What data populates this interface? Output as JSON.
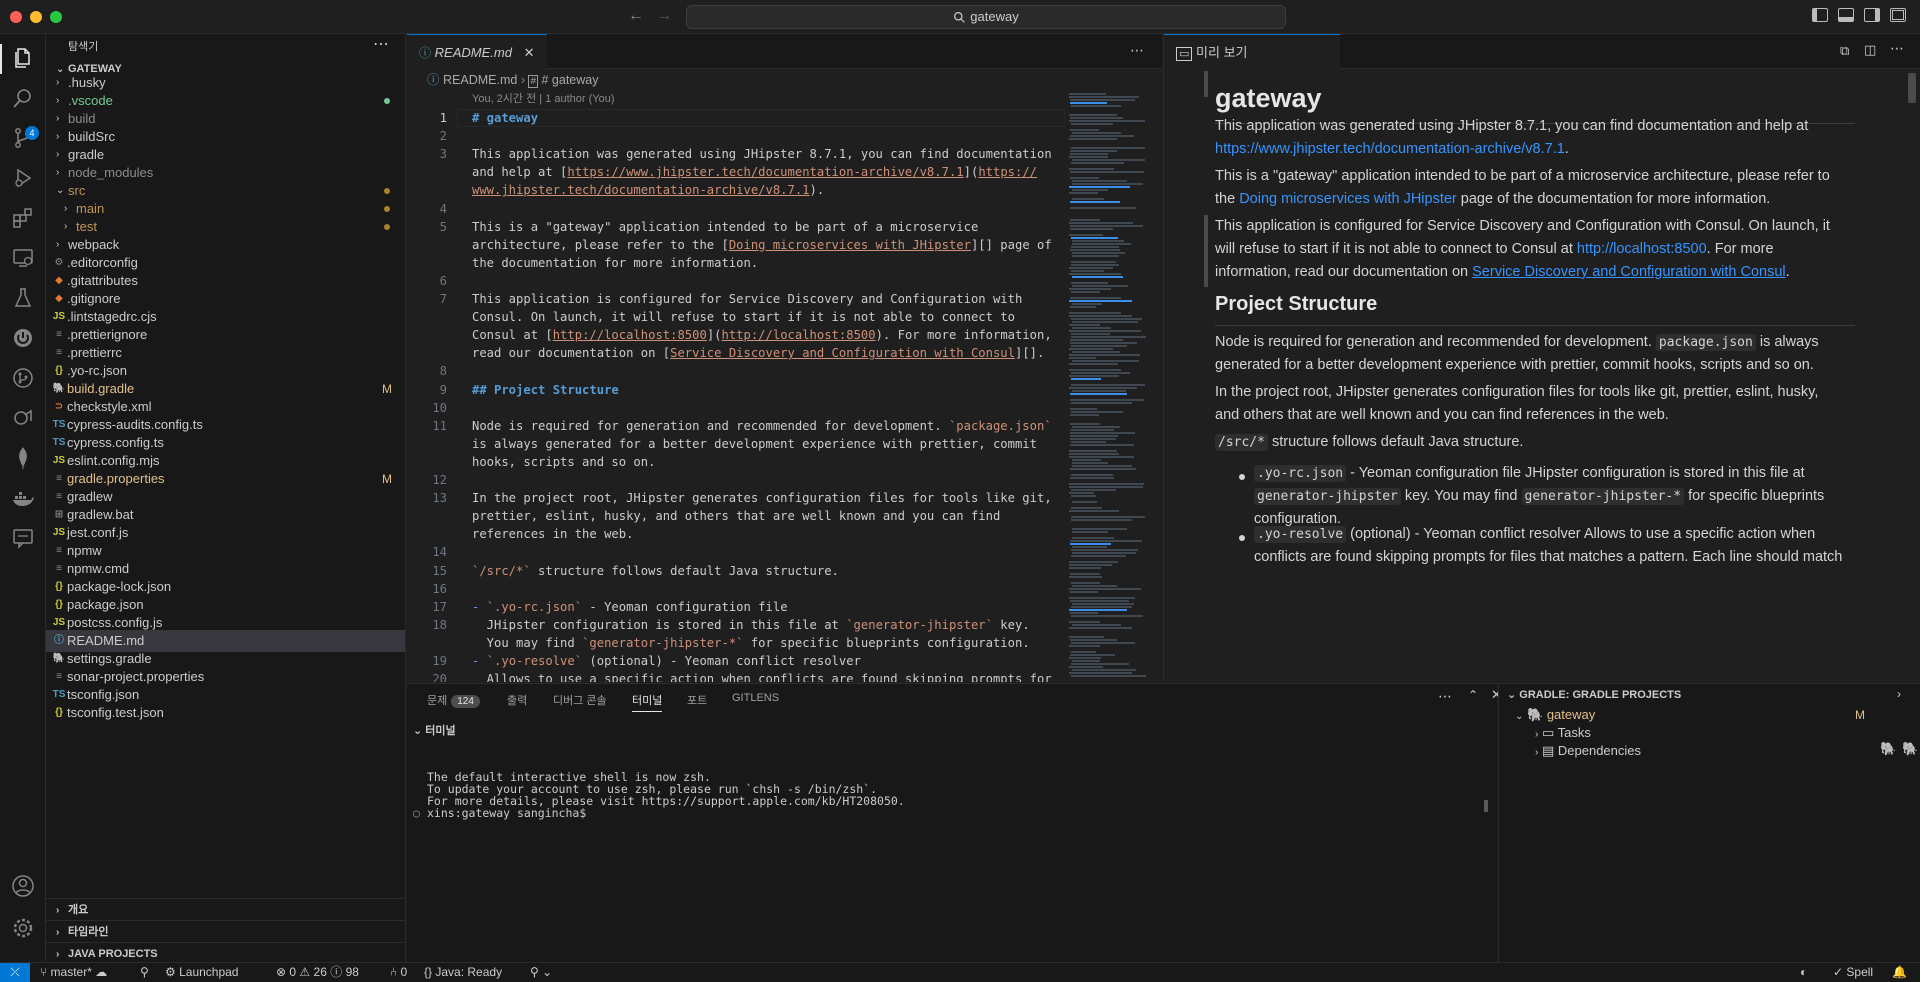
{
  "titlebar": {
    "search_text": "gateway"
  },
  "activity_bar": {
    "icons": [
      "explorer-icon",
      "search-icon",
      "source-control-icon",
      "run-debug-icon",
      "extensions-icon",
      "remote-explorer-icon",
      "testing-icon",
      "spring-boot-icon",
      "gitlens-icon",
      "gradle-icon",
      "mongodb-icon",
      "docker-icon",
      "comments-icon",
      "account-icon",
      "settings-gear-icon"
    ],
    "source_control_badge": "4"
  },
  "sidebar": {
    "title": "탐색기",
    "root": "GATEWAY",
    "items": [
      {
        "label": ".husky",
        "type": "folder",
        "color": "#cccccc"
      },
      {
        "label": ".vscode",
        "type": "folder",
        "color": "#73c991",
        "status": "dot-green"
      },
      {
        "label": "build",
        "type": "folder",
        "color": "#8c8c8c"
      },
      {
        "label": "buildSrc",
        "type": "folder",
        "color": "#cccccc"
      },
      {
        "label": "gradle",
        "type": "folder",
        "color": "#cccccc"
      },
      {
        "label": "node_modules",
        "type": "folder",
        "color": "#8c8c8c"
      },
      {
        "label": "src",
        "type": "folder-open",
        "color": "#c09553",
        "status": "dot-yellow"
      },
      {
        "label": "main",
        "type": "folder",
        "color": "#c09553",
        "status": "dot-yellow",
        "depth": 1
      },
      {
        "label": "test",
        "type": "folder",
        "color": "#c09553",
        "status": "dot-yellow",
        "depth": 1
      },
      {
        "label": "webpack",
        "type": "folder",
        "color": "#cccccc"
      },
      {
        "label": ".editorconfig",
        "type": "file",
        "icon": "gear",
        "color": "#cccccc"
      },
      {
        "label": ".gitattributes",
        "type": "file",
        "icon": "git",
        "color": "#cccccc"
      },
      {
        "label": ".gitignore",
        "type": "file",
        "icon": "git",
        "color": "#cccccc"
      },
      {
        "label": ".lintstagedrc.cjs",
        "type": "file",
        "icon": "JS",
        "color": "#cccccc"
      },
      {
        "label": ".prettierignore",
        "type": "file",
        "icon": "lines",
        "color": "#cccccc"
      },
      {
        "label": ".prettierrc",
        "type": "file",
        "icon": "lines",
        "color": "#cccccc"
      },
      {
        "label": ".yo-rc.json",
        "type": "file",
        "icon": "{}",
        "color": "#cccccc"
      },
      {
        "label": "build.gradle",
        "type": "file",
        "icon": "elephant",
        "color": "#e2c08d",
        "mark": "M"
      },
      {
        "label": "checkstyle.xml",
        "type": "file",
        "icon": "rss",
        "color": "#cccccc"
      },
      {
        "label": "cypress-audits.config.ts",
        "type": "file",
        "icon": "TS",
        "color": "#cccccc"
      },
      {
        "label": "cypress.config.ts",
        "type": "file",
        "icon": "TS",
        "color": "#cccccc"
      },
      {
        "label": "eslint.config.mjs",
        "type": "file",
        "icon": "JS",
        "color": "#cccccc"
      },
      {
        "label": "gradle.properties",
        "type": "file",
        "icon": "lines",
        "color": "#e2c08d",
        "mark": "M"
      },
      {
        "label": "gradlew",
        "type": "file",
        "icon": "lines",
        "color": "#cccccc"
      },
      {
        "label": "gradlew.bat",
        "type": "file",
        "icon": "win",
        "color": "#cccccc"
      },
      {
        "label": "jest.conf.js",
        "type": "file",
        "icon": "JS",
        "color": "#cccccc"
      },
      {
        "label": "npmw",
        "type": "file",
        "icon": "lines",
        "color": "#cccccc"
      },
      {
        "label": "npmw.cmd",
        "type": "file",
        "icon": "lines",
        "color": "#cccccc"
      },
      {
        "label": "package-lock.json",
        "type": "file",
        "icon": "{}",
        "color": "#cccccc"
      },
      {
        "label": "package.json",
        "type": "file",
        "icon": "{}",
        "color": "#cccccc"
      },
      {
        "label": "postcss.config.js",
        "type": "file",
        "icon": "JS",
        "color": "#cccccc"
      },
      {
        "label": "README.md",
        "type": "file",
        "icon": "info",
        "color": "#cccccc",
        "selected": true
      },
      {
        "label": "settings.gradle",
        "type": "file",
        "icon": "elephant",
        "color": "#cccccc"
      },
      {
        "label": "sonar-project.properties",
        "type": "file",
        "icon": "lines",
        "color": "#cccccc"
      },
      {
        "label": "tsconfig.json",
        "type": "file",
        "icon": "TS",
        "color": "#cccccc"
      },
      {
        "label": "tsconfig.test.json",
        "type": "file",
        "icon": "{}",
        "color": "#cccccc"
      }
    ],
    "sections": [
      "개요",
      "타임라인",
      "JAVA PROJECTS"
    ]
  },
  "editor": {
    "tab_label": "README.md",
    "breadcrumb_file": "README.md",
    "breadcrumb_symbol": "# gateway",
    "blame": "You, 2시간 전 | 1 author (You)",
    "lines": [
      {
        "n": "1",
        "segs": [
          [
            "h1",
            "# gateway"
          ]
        ]
      },
      {
        "n": "2",
        "segs": []
      },
      {
        "n": "3",
        "segs": [
          [
            "t",
            "This application was generated using JHipster 8.7.1, you can find documentation"
          ]
        ]
      },
      {
        "n": "",
        "segs": [
          [
            "t",
            "and help at ["
          ],
          [
            "link",
            "https://www.jhipster.tech/documentation-archive/v8.7.1"
          ],
          [
            "t",
            "]("
          ],
          [
            "link",
            "https://"
          ]
        ]
      },
      {
        "n": "",
        "segs": [
          [
            "link",
            "www.jhipster.tech/documentation-archive/v8.7.1"
          ],
          [
            "t",
            ")."
          ]
        ]
      },
      {
        "n": "4",
        "segs": []
      },
      {
        "n": "5",
        "segs": [
          [
            "t",
            "This is a \"gateway\" application intended to be part of a microservice"
          ]
        ]
      },
      {
        "n": "",
        "segs": [
          [
            "t",
            "architecture, please refer to the ["
          ],
          [
            "link",
            "Doing microservices with JHipster"
          ],
          [
            "t",
            "][] page of"
          ]
        ]
      },
      {
        "n": "",
        "segs": [
          [
            "t",
            "the documentation for more information."
          ]
        ]
      },
      {
        "n": "6",
        "segs": []
      },
      {
        "n": "7",
        "segs": [
          [
            "t",
            "This application is configured for Service Discovery and Configuration with"
          ]
        ]
      },
      {
        "n": "",
        "segs": [
          [
            "t",
            "Consul. On launch, it will refuse to start if it is not able to connect to"
          ]
        ]
      },
      {
        "n": "",
        "segs": [
          [
            "t",
            "Consul at ["
          ],
          [
            "link",
            "http://localhost:8500"
          ],
          [
            "t",
            "]("
          ],
          [
            "link",
            "http://localhost:8500"
          ],
          [
            "t",
            "). For more information,"
          ]
        ]
      },
      {
        "n": "",
        "segs": [
          [
            "t",
            "read our documentation on ["
          ],
          [
            "link",
            "Service Discovery and Configuration with Consul"
          ],
          [
            "t",
            "][]."
          ]
        ]
      },
      {
        "n": "8",
        "segs": []
      },
      {
        "n": "9",
        "segs": [
          [
            "h1",
            "## Project Structure"
          ]
        ]
      },
      {
        "n": "10",
        "segs": []
      },
      {
        "n": "11",
        "segs": [
          [
            "t",
            "Node is required for generation and recommended for development. "
          ],
          [
            "code",
            "`package.json`"
          ]
        ]
      },
      {
        "n": "",
        "segs": [
          [
            "t",
            "is always generated for a better development experience with prettier, commit"
          ]
        ]
      },
      {
        "n": "",
        "segs": [
          [
            "t",
            "hooks, scripts and so on."
          ]
        ]
      },
      {
        "n": "12",
        "segs": []
      },
      {
        "n": "13",
        "segs": [
          [
            "t",
            "In the project root, JHipster generates configuration files for tools like git,"
          ]
        ]
      },
      {
        "n": "",
        "segs": [
          [
            "t",
            "prettier, eslint, husky, and others that are well known and you can find"
          ]
        ]
      },
      {
        "n": "",
        "segs": [
          [
            "t",
            "references in the web."
          ]
        ]
      },
      {
        "n": "14",
        "segs": []
      },
      {
        "n": "15",
        "segs": [
          [
            "code",
            "`/src/*`"
          ],
          [
            "t",
            " structure follows default Java structure."
          ]
        ]
      },
      {
        "n": "16",
        "segs": []
      },
      {
        "n": "17",
        "segs": [
          [
            "bullet",
            "- "
          ],
          [
            "code",
            "`.yo-rc.json`"
          ],
          [
            "t",
            " - Yeoman configuration file"
          ]
        ]
      },
      {
        "n": "18",
        "segs": [
          [
            "t",
            "  JHipster configuration is stored in this file at "
          ],
          [
            "code",
            "`generator-jhipster`"
          ],
          [
            "t",
            " key."
          ]
        ]
      },
      {
        "n": "",
        "segs": [
          [
            "t",
            "  You may find "
          ],
          [
            "code",
            "`generator-jhipster-*`"
          ],
          [
            "t",
            " for specific blueprints configuration."
          ]
        ]
      },
      {
        "n": "19",
        "segs": [
          [
            "bullet",
            "- "
          ],
          [
            "code",
            "`.yo-resolve`"
          ],
          [
            "t",
            " (optional) - Yeoman conflict resolver"
          ]
        ]
      },
      {
        "n": "20",
        "segs": [
          [
            "t",
            "  Allows to use a specific action when conflicts are found skipping prompts for"
          ]
        ]
      }
    ]
  },
  "preview": {
    "tab_label": "미리 보기 README.md",
    "h1": "gateway",
    "p1_a": "This application was generated using JHipster 8.7.1, you can find documentation and help at",
    "p1_link": "https://www.jhipster.tech/documentation-archive/v8.7.1",
    "p1_end": ".",
    "p2_a": "This is a \"gateway\" application intended to be part of a microservice architecture, please refer to",
    "p2_b": "the ",
    "p2_link": "Doing microservices with JHipster",
    "p2_c": " page of the documentation for more information.",
    "p3_a": "This application is configured for Service Discovery and Configuration with Consul. On launch, it",
    "p3_b": "will refuse to start if it is not able to connect to Consul at ",
    "p3_link": "http://localhost:8500",
    "p3_c": ". For more",
    "p3_d": "information, read our documentation on ",
    "p3_link2": "Service Discovery and Configuration with Consul",
    "p3_e": ".",
    "h2": "Project Structure",
    "p4_a": "Node is required for generation and recommended for development. ",
    "p4_code": "package.json",
    "p4_b": " is always",
    "p4_c": "generated for a better development experience with prettier, commit hooks, scripts and so on.",
    "p5_a": "In the project root, JHipster generates configuration files for tools like git, prettier, eslint, husky,",
    "p5_b": "and others that are well known and you can find references in the web.",
    "p6_code": "/src/*",
    "p6_b": " structure follows default Java structure.",
    "li1_code": ".yo-rc.json",
    "li1_a": " - Yeoman configuration file JHipster configuration is stored in this file at",
    "li1_code2": "generator-jhipster",
    "li1_b": " key. You may find ",
    "li1_code3": "generator-jhipster-*",
    "li1_c": " for specific blueprints",
    "li1_d": "configuration.",
    "li2_code": ".yo-resolve",
    "li2_a": " (optional) - Yeoman conflict resolver Allows to use a specific action when",
    "li2_b": "conflicts are found skipping prompts for files that matches a pattern. Each line should match"
  },
  "panel": {
    "tabs": [
      "문제",
      "출력",
      "디버그 콘솔",
      "터미널",
      "포트",
      "GITLENS"
    ],
    "problems_count": "124",
    "active_tab": "터미널",
    "terminal_title": "터미널",
    "terminal_lines": [
      "The default interactive shell is now zsh.",
      "To update your account to use zsh, please run `chsh -s /bin/zsh`.",
      "For more details, please visit https://support.apple.com/kb/HT208050.",
      "xins:gateway sangincha$ "
    ]
  },
  "gradle": {
    "title": "GRADLE: GRADLE PROJECTS",
    "project": "gateway",
    "project_mark": "M",
    "children": [
      "Tasks",
      "Dependencies"
    ]
  },
  "statusbar": {
    "branch": "master*",
    "launchpad": "Launchpad",
    "errors": "0",
    "warnings": "26",
    "infos": "98",
    "ports": "0",
    "java": "Java: Ready",
    "spell": "Spell"
  }
}
